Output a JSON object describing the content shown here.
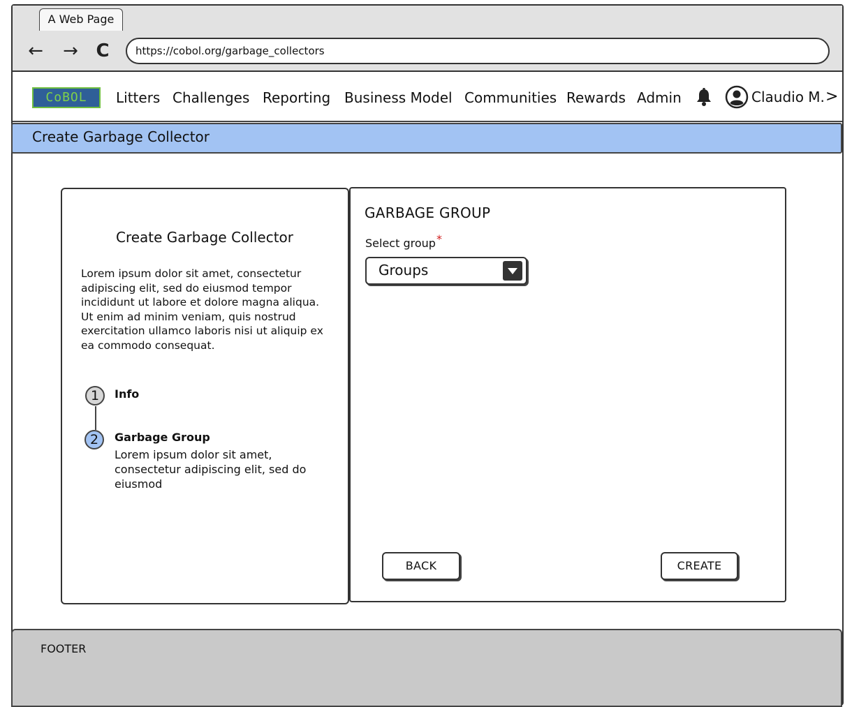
{
  "browser": {
    "tab_title": "A Web Page",
    "url": "https://cobol.org/garbage_collectors",
    "back_glyph": "←",
    "forward_glyph": "→",
    "reload_glyph": "C"
  },
  "nav": {
    "logo_text": "CoBOL",
    "links": [
      "Litters",
      "Challenges",
      "Reporting",
      "Business Model",
      "Communities",
      "Rewards",
      "Admin"
    ],
    "user_name": "Claudio M.",
    "chevron": ">"
  },
  "page": {
    "title": "Create Garbage Collector"
  },
  "sidebar": {
    "title": "Create Garbage Collector",
    "description": "Lorem ipsum dolor sit amet, consectetur adipiscing elit, sed do eiusmod tempor incididunt ut labore et dolore magna aliqua. Ut enim ad minim veniam, quis nostrud exercitation ullamco laboris nisi ut aliquip ex ea commodo consequat.",
    "steps": [
      {
        "number": "1",
        "label": "Info"
      },
      {
        "number": "2",
        "label": "Garbage Group",
        "description": "Lorem ipsum dolor sit amet, consectetur adipiscing elit, sed do eiusmod"
      }
    ]
  },
  "form": {
    "section_heading": "GARBAGE GROUP",
    "select_label": "Select group",
    "required_mark": "*",
    "select_value": "Groups",
    "back_label": "BACK",
    "create_label": "CREATE"
  },
  "footer": {
    "text": "FOOTER"
  },
  "colors": {
    "title_bar": "#a2c3f3",
    "active_step": "#a2c3f3",
    "footer": "#c9c9c9",
    "logo_bg": "#2f5f98",
    "logo_text": "#7fd04a",
    "required": "#d21e1e"
  },
  "icons": [
    "back-arrow-icon",
    "forward-arrow-icon",
    "reload-icon",
    "bell-icon",
    "user-avatar-icon",
    "chevron-right-icon",
    "dropdown-icon"
  ]
}
